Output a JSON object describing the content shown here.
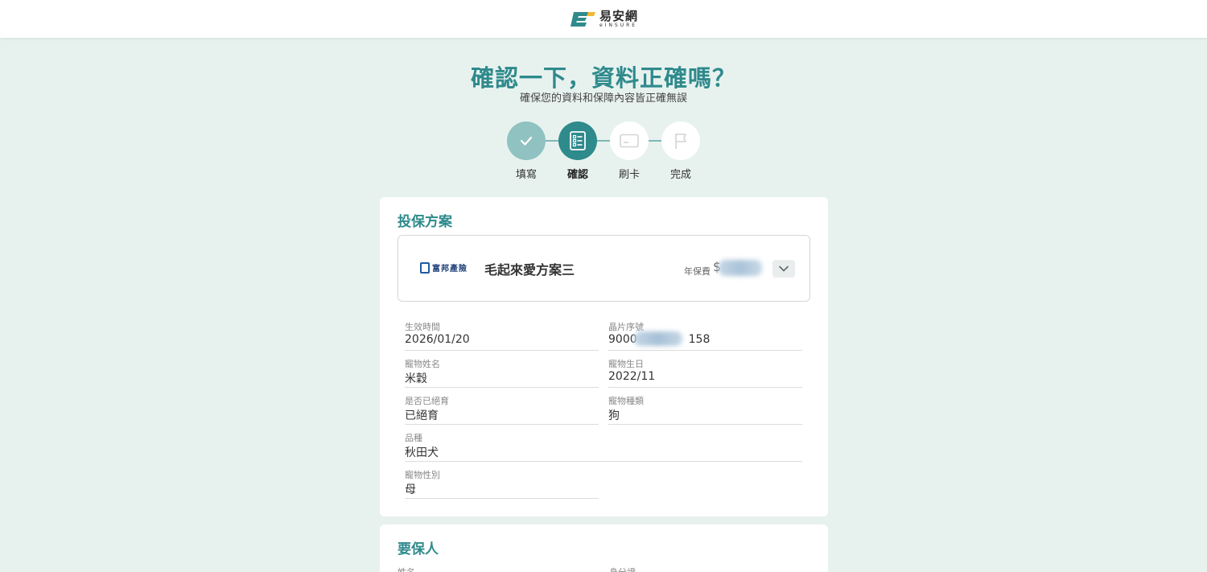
{
  "header": {
    "logo_cn": "易安網",
    "logo_en": "eINSURE"
  },
  "page": {
    "title": "確認一下，資料正確嗎？",
    "subtitle": "確保您的資料和保障內容皆正確無誤"
  },
  "stepper": {
    "steps": [
      {
        "label": "填寫",
        "state": "done",
        "icon": "check-icon"
      },
      {
        "label": "確認",
        "state": "active",
        "icon": "checklist-icon"
      },
      {
        "label": "刷卡",
        "state": "todo",
        "icon": "credit-card-icon"
      },
      {
        "label": "完成",
        "state": "todo",
        "icon": "flag-icon"
      }
    ]
  },
  "plan_section": {
    "title": "投保方案",
    "insurer": "富邦產險",
    "plan_name": "毛起來愛方案三",
    "premium_label": "年保費",
    "premium_prefix": "$"
  },
  "details": {
    "effective_date": {
      "label": "生效時間",
      "value": "2026/01/20"
    },
    "chip_number": {
      "label": "晶片序號",
      "value_start": "9000",
      "value_end": "158"
    },
    "pet_name": {
      "label": "寵物姓名",
      "value": "米穀"
    },
    "pet_birthday": {
      "label": "寵物生日",
      "value": "2022/11"
    },
    "neutered": {
      "label": "是否已絕育",
      "value": "已絕育"
    },
    "pet_type": {
      "label": "寵物種類",
      "value": "狗"
    },
    "breed": {
      "label": "品種",
      "value": "秋田犬"
    },
    "pet_gender": {
      "label": "寵物性別",
      "value": "母"
    }
  },
  "applicant_section": {
    "title": "要保人",
    "name_label": "姓名",
    "id_label": "身分證"
  },
  "colors": {
    "accent": "#2f8a8c",
    "step_done": "#8fc2c0",
    "background": "#e7f2ef"
  }
}
